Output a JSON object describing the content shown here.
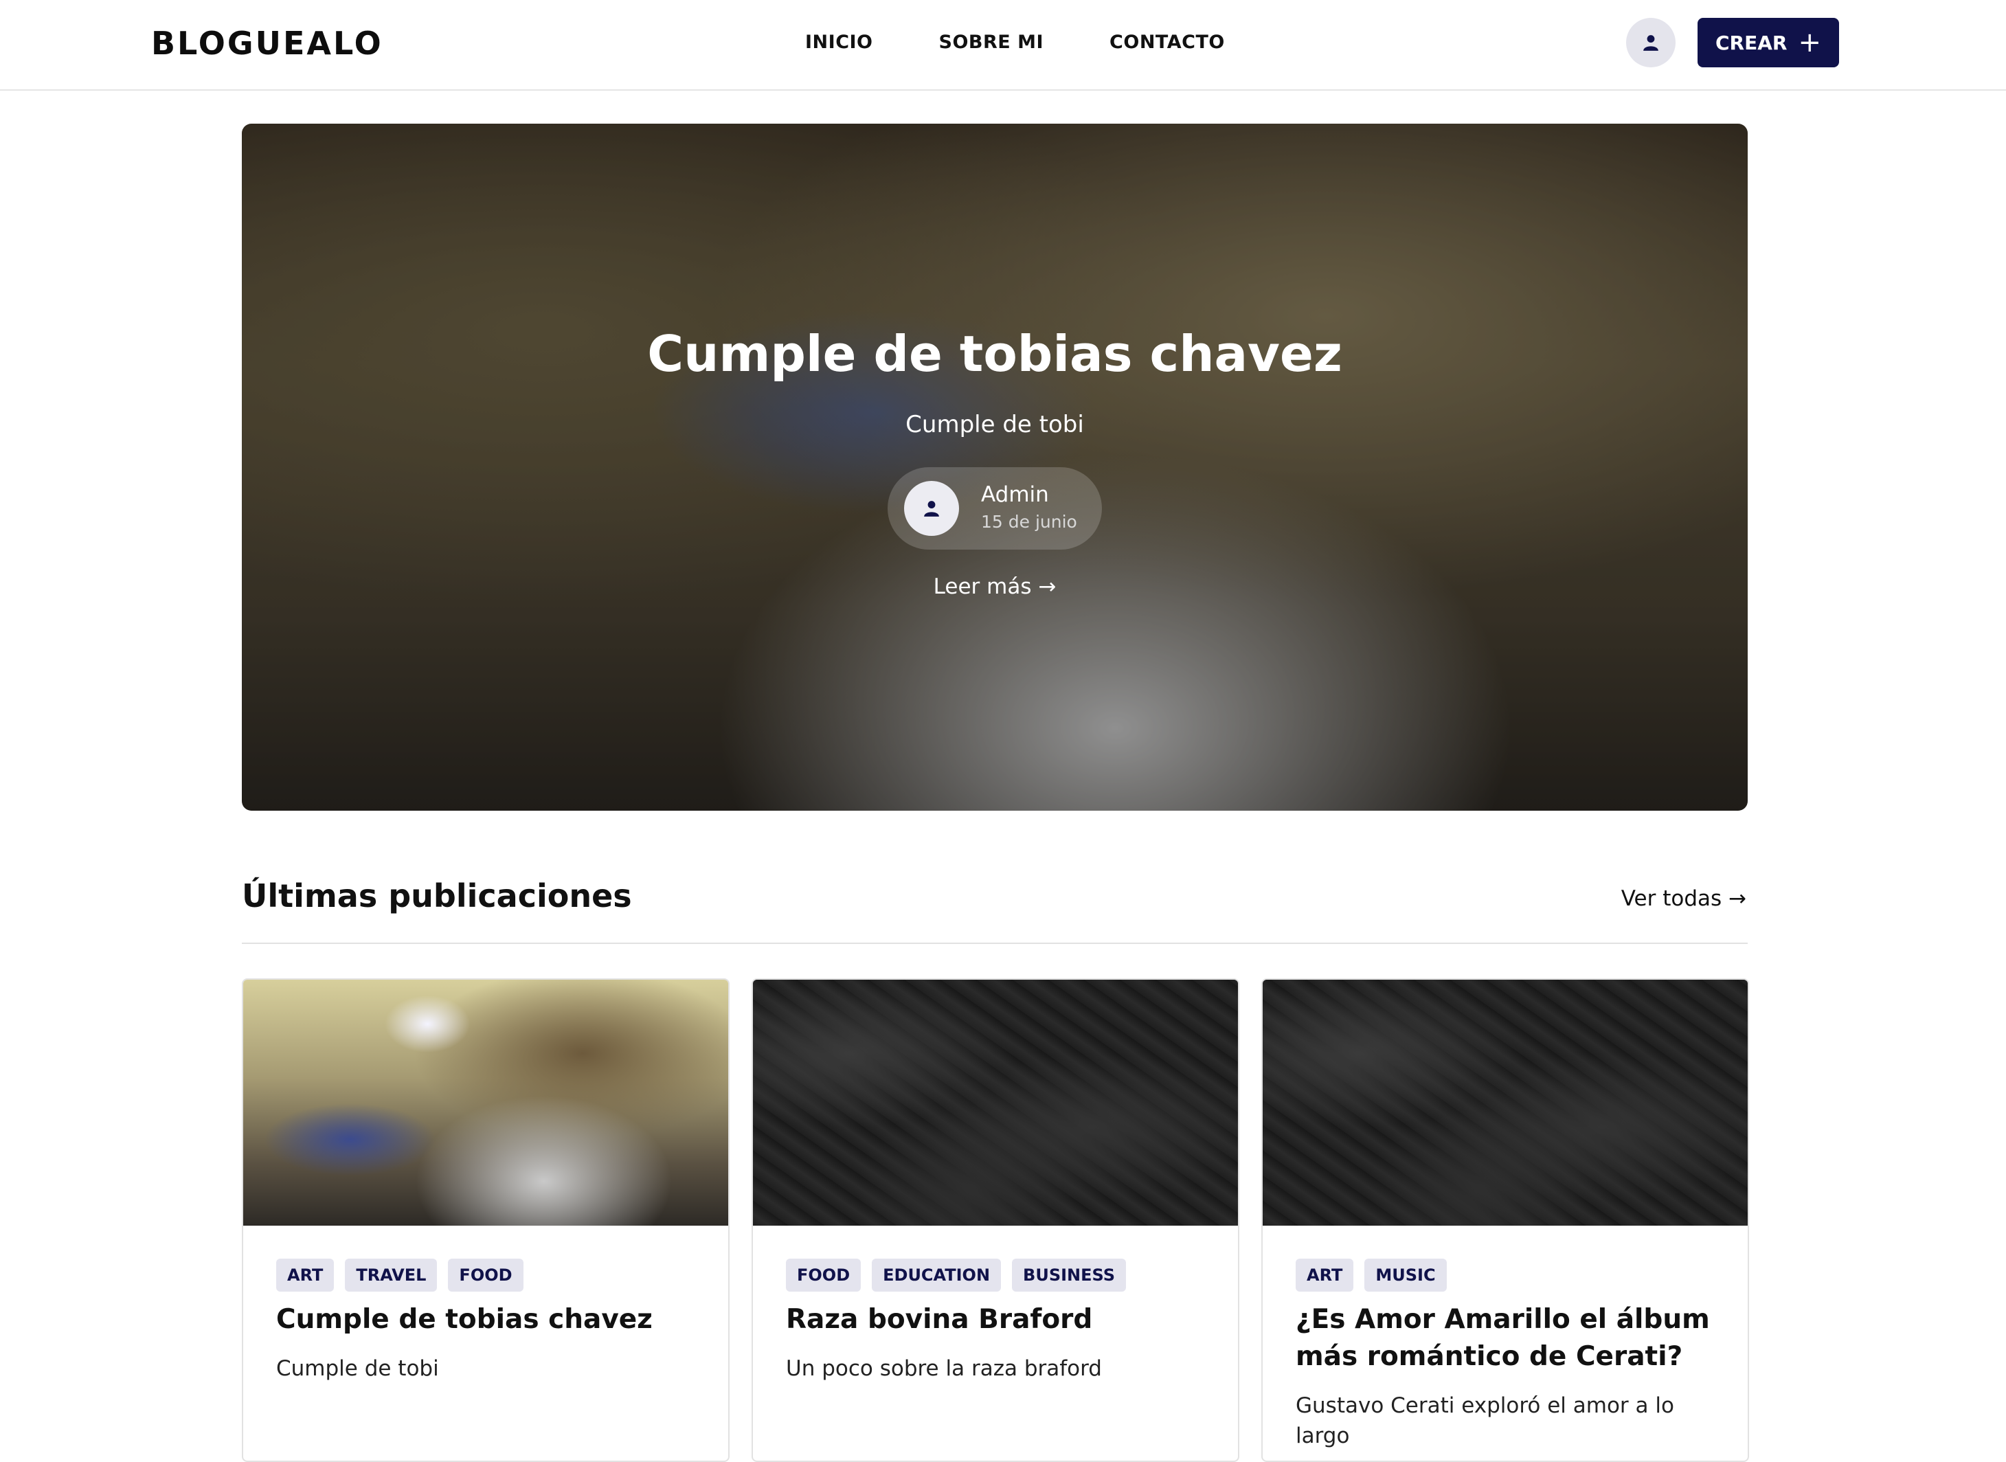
{
  "header": {
    "logo": "BLOGUEALO",
    "nav": [
      "INICIO",
      "SOBRE MI",
      "CONTACTO"
    ],
    "create_label": "CREAR",
    "create_icon": "plus-icon",
    "user_icon": "user-icon"
  },
  "hero": {
    "title": "Cumple de tobias chavez",
    "subtitle": "Cumple de tobi",
    "author": "Admin",
    "date": "15 de junio",
    "read_more": "Leer más →"
  },
  "latest": {
    "title": "Últimas publicaciones",
    "see_all": "Ver todas →"
  },
  "posts": [
    {
      "tags": [
        "ART",
        "TRAVEL",
        "FOOD"
      ],
      "title": "Cumple de tobias chavez",
      "description": "Cumple de tobi"
    },
    {
      "tags": [
        "FOOD",
        "EDUCATION",
        "BUSINESS"
      ],
      "title": "Raza bovina Braford",
      "description": "Un poco sobre la raza braford"
    },
    {
      "tags": [
        "ART",
        "MUSIC"
      ],
      "title": "¿Es Amor Amarillo el álbum más romántico de Cerati?",
      "description": "Gustavo Cerati exploró el amor a lo largo"
    }
  ],
  "colors": {
    "brand": "#10124a",
    "tag_bg": "#e4e4ee"
  }
}
